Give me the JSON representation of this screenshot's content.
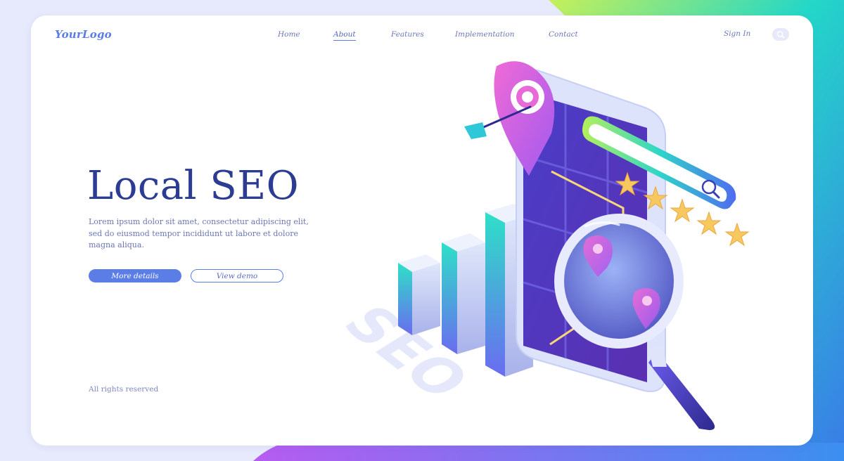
{
  "brand": {
    "logo": "YourLogo"
  },
  "nav": {
    "items": [
      {
        "label": "Home",
        "active": false
      },
      {
        "label": "About",
        "active": true
      },
      {
        "label": "Features",
        "active": false
      },
      {
        "label": "Implementation",
        "active": false
      },
      {
        "label": "Contact",
        "active": false
      }
    ],
    "sign_in": "Sign In",
    "search_icon": "search-icon"
  },
  "hero": {
    "title": "Local SEO",
    "description": "Lorem ipsum dolor sit amet, consectetur adipiscing elit, sed do eiusmod tempor incididunt ut labore et dolore magna aliqua.",
    "primary_button": "More details",
    "secondary_button": "View demo"
  },
  "illustration": {
    "shadow_text": "SEO",
    "rating_stars": 5,
    "bar_chart_levels": [
      0.3,
      0.55,
      0.85
    ]
  },
  "footer": {
    "text": "All rights reserved"
  },
  "colors": {
    "accent": "#5b7de6",
    "title": "#2b3c92",
    "body_text": "#6b76b2",
    "gradient_start": "#b5f05a",
    "gradient_end": "#2e8df0"
  }
}
